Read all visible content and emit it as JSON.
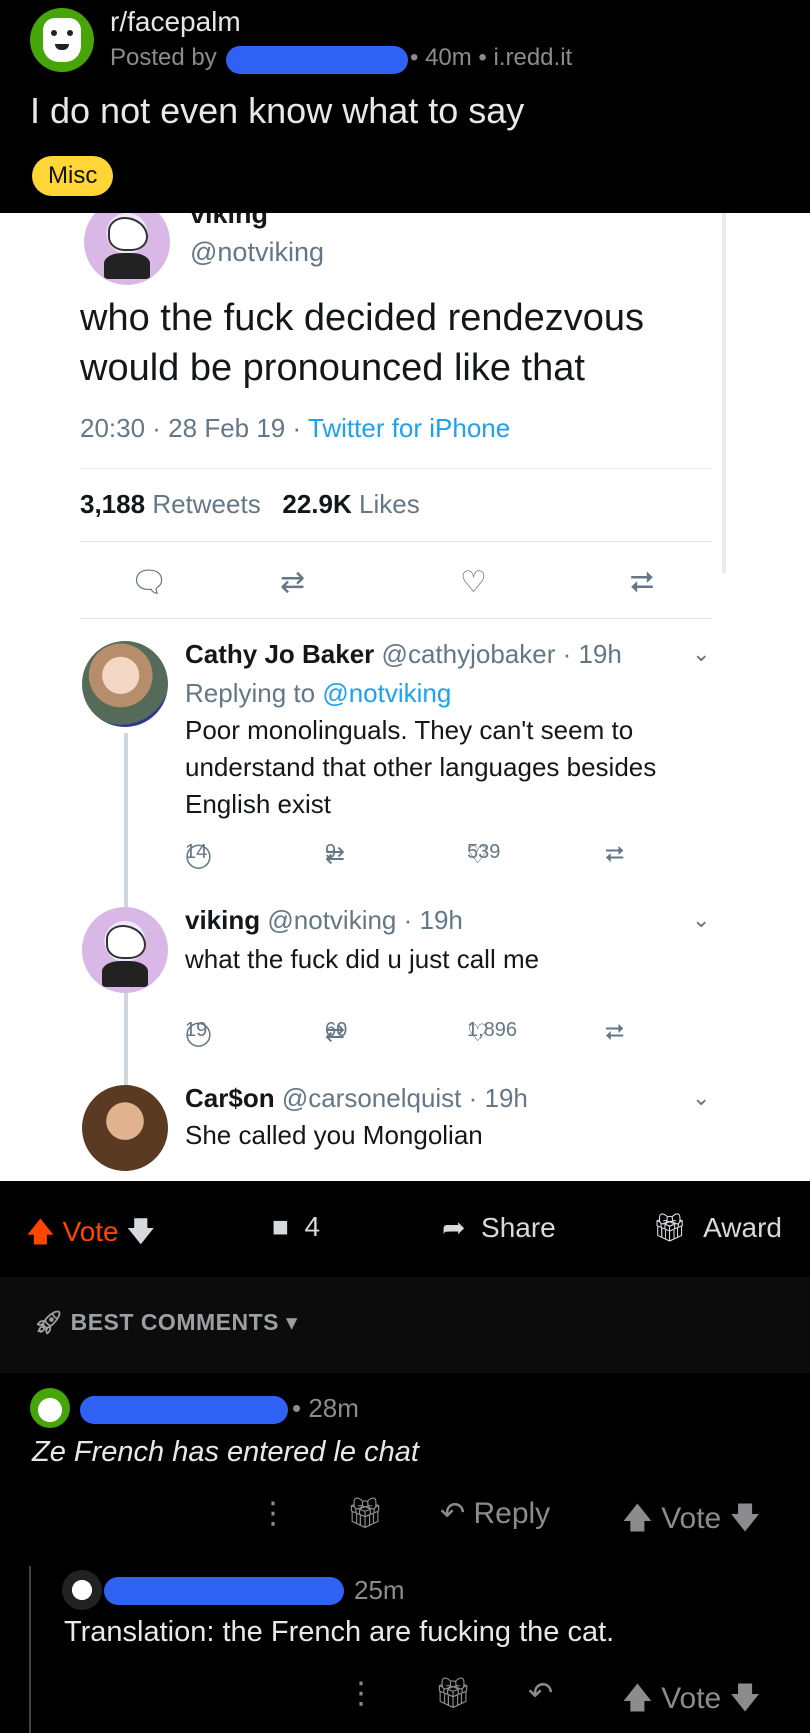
{
  "post": {
    "subreddit": "r/facepalm",
    "posted_by_label": "Posted by",
    "meta": "• 40m • i.redd.it",
    "title": "I do not even know what to say",
    "flair": "Misc"
  },
  "tweet": {
    "name_clipped": "viking",
    "handle": "@notviking",
    "text": "who the fuck decided rendezvous would be pronounced like that",
    "time": "20:30 · 28 Feb 19 · ",
    "source": "Twitter for iPhone",
    "retweets_count": "3,188",
    "retweets_label": "Retweets",
    "likes_count": "22.9K",
    "likes_label": "Likes"
  },
  "replies": [
    {
      "name": "Cathy Jo Baker",
      "handle_time": "@cathyjobaker · 19h",
      "replying_prefix": "Replying to ",
      "replying_to": "@notviking",
      "text": "Poor monolinguals. They can't seem to understand that other languages besides English exist",
      "replies": "14",
      "retweets": "9",
      "likes": "539"
    },
    {
      "name": "viking",
      "handle_time": "@notviking · 19h",
      "text": "what the fuck did u just call me",
      "replies": "19",
      "retweets": "60",
      "likes": "1,896"
    },
    {
      "name": "Car$on",
      "handle_time": "@carsonelquist · 19h",
      "text": "She called you Mongolian"
    }
  ],
  "vote_bar": {
    "vote": "Vote",
    "comments": "4",
    "share": "Share",
    "award": "Award"
  },
  "best_comments": {
    "label": "BEST COMMENTS"
  },
  "comments": [
    {
      "time": "• 28m",
      "text": "Ze French has entered le chat",
      "reply": "Reply",
      "vote": "Vote"
    },
    {
      "time": "25m",
      "text": "Translation: the French are fucking the cat.",
      "vote": "Vote"
    }
  ],
  "colors": {
    "accent_upvote": "#ff4500",
    "redaction": "#2f62f2",
    "flair": "#ffd635",
    "twitter_blue": "#1da1f2"
  }
}
